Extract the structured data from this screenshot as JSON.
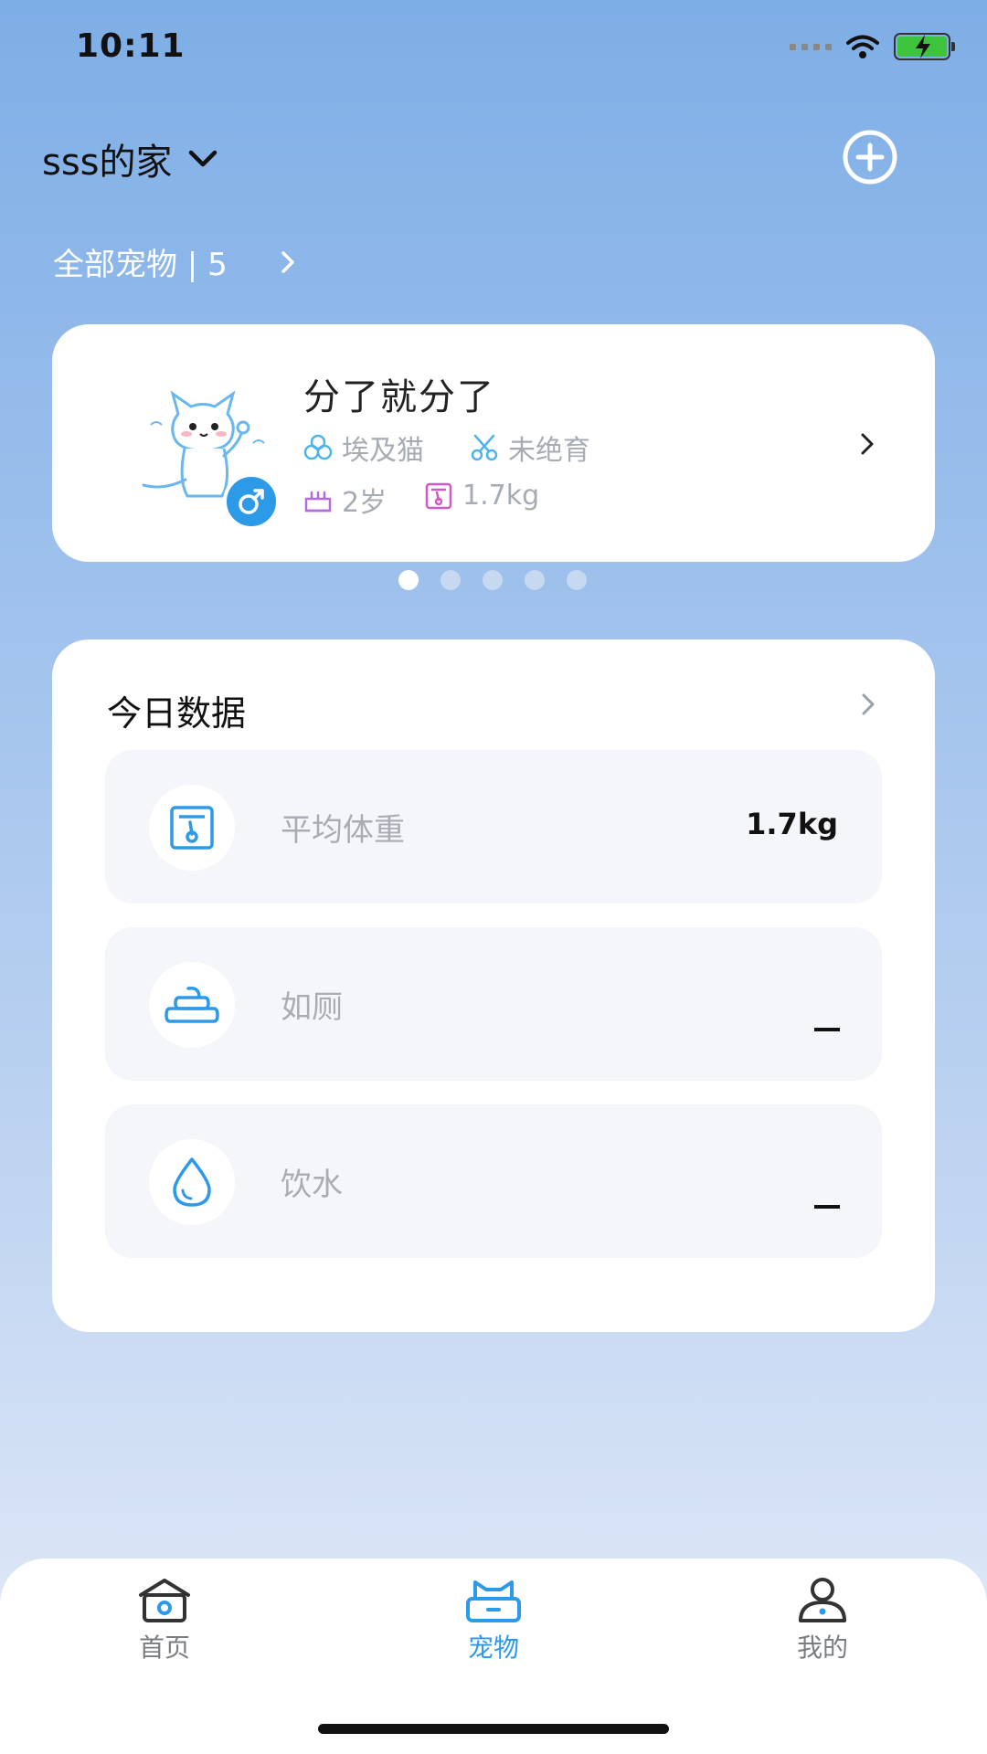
{
  "status_bar": {
    "time": "10:11"
  },
  "header": {
    "home_name": "sss的家",
    "add_icon": "plus-circle-icon"
  },
  "pets_link": {
    "label": "全部宠物 | 5"
  },
  "pet_card": {
    "name": "分了就分了",
    "breed": "埃及猫",
    "neutered": "未绝育",
    "age": "2岁",
    "weight": "1.7kg",
    "gender_icon": "male-icon"
  },
  "pager": {
    "total": 5,
    "active_index": 0
  },
  "today_data": {
    "title": "今日数据",
    "rows": [
      {
        "label": "平均体重",
        "value": "1.7kg",
        "icon": "scale-icon"
      },
      {
        "label": "如厕",
        "value": "",
        "icon": "poop-icon"
      },
      {
        "label": "饮水",
        "value": "",
        "icon": "water-drop-icon"
      }
    ]
  },
  "tabbar": {
    "tabs": [
      {
        "label": "首页",
        "icon": "home-icon"
      },
      {
        "label": "宠物",
        "icon": "pet-icon"
      },
      {
        "label": "我的",
        "icon": "profile-icon"
      }
    ],
    "active": "宠物"
  },
  "colors": {
    "accent": "#2d9ae8",
    "background_top": "#7eaee6",
    "background_bottom": "#e6edf8"
  }
}
